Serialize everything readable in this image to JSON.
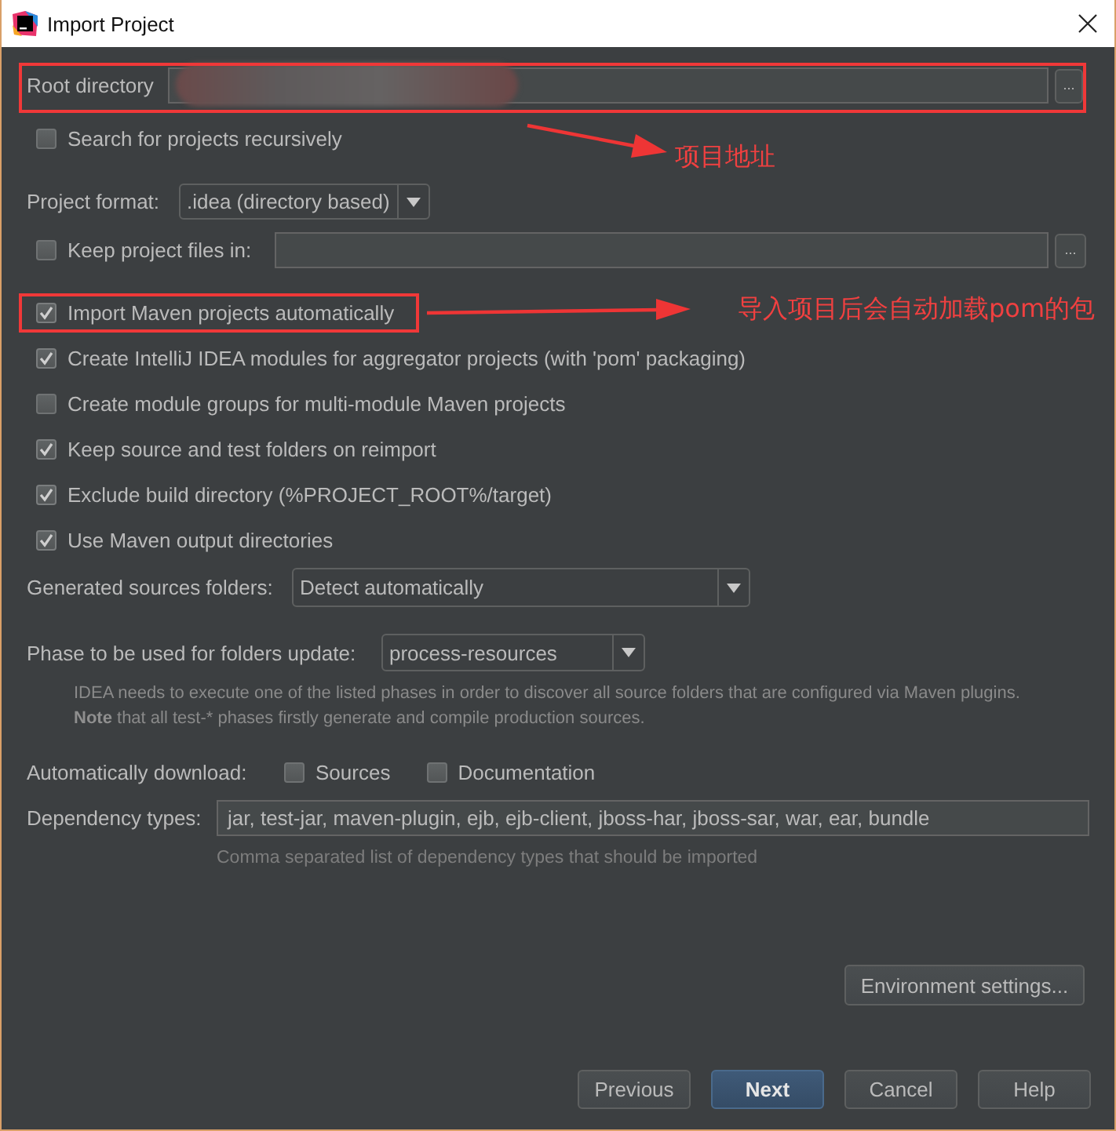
{
  "window": {
    "title": "Import Project"
  },
  "root_directory": {
    "label": "Root directory",
    "blurred": true,
    "browse": "...",
    "highlighted": true,
    "callout": "项目地址"
  },
  "search_recursively": {
    "label": "Search for projects recursively",
    "checked": false
  },
  "project_format": {
    "label": "Project format:",
    "value": ".idea (directory based)"
  },
  "keep_project_files": {
    "label": "Keep project files in:",
    "checked": false,
    "browse": "..."
  },
  "maven_options": [
    {
      "label": "Import Maven projects automatically",
      "checked": true,
      "highlighted": true,
      "callout": "导入项目后会自动加载pom的包"
    },
    {
      "label": "Create IntelliJ IDEA modules for aggregator projects (with 'pom' packaging)",
      "checked": true,
      "highlighted": false
    },
    {
      "label": "Create module groups for multi-module Maven projects",
      "checked": false,
      "highlighted": false
    },
    {
      "label": "Keep source and test folders on reimport",
      "checked": true,
      "highlighted": false
    },
    {
      "label": "Exclude build directory (%PROJECT_ROOT%/target)",
      "checked": true,
      "highlighted": false
    },
    {
      "label": "Use Maven output directories",
      "checked": true,
      "highlighted": false
    }
  ],
  "generated_sources": {
    "label": "Generated sources folders:",
    "value": "Detect automatically"
  },
  "phase": {
    "label": "Phase to be used for folders update:",
    "value": "process-resources",
    "notes": [
      "IDEA needs to execute one of the listed phases in order to discover all source folders that are configured via Maven plugins.",
      "**Note** that all test-* phases firstly generate and compile production sources."
    ]
  },
  "auto_download": {
    "label": "Automatically download:",
    "options": [
      {
        "label": "Sources",
        "checked": false
      },
      {
        "label": "Documentation",
        "checked": false
      }
    ]
  },
  "dependency_types": {
    "label": "Dependency types:",
    "value": "jar, test-jar, maven-plugin, ejb, ejb-client, jboss-har, jboss-sar, war, ear, bundle",
    "hint": "Comma separated list of dependency types that should be imported"
  },
  "environment_settings": {
    "label": "Environment settings..."
  },
  "buttons": [
    {
      "label": "Previous",
      "default": false
    },
    {
      "label": "Next",
      "default": true
    },
    {
      "label": "Cancel",
      "default": false
    },
    {
      "label": "Help",
      "default": false
    }
  ]
}
